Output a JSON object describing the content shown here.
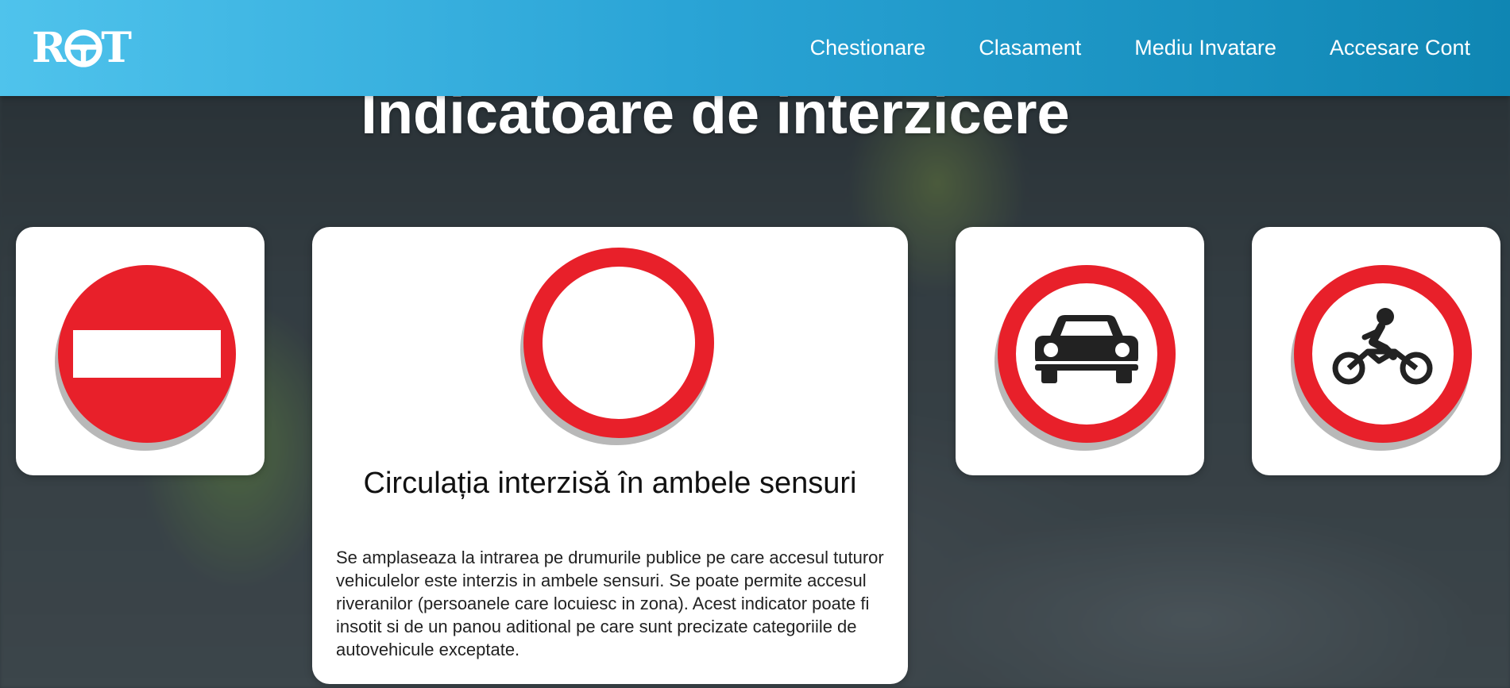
{
  "header": {
    "logo_text_left": "R",
    "logo_text_right": "T",
    "nav": [
      {
        "label": "Chestionare"
      },
      {
        "label": "Clasament"
      },
      {
        "label": "Mediu Invatare"
      },
      {
        "label": "Accesare Cont"
      }
    ]
  },
  "page_title": "Indicatoare de interzicere",
  "signs": [
    {
      "icon": "no-entry-sign-icon"
    },
    {
      "icon": "no-vehicles-both-directions-sign-icon",
      "title": "Circulația interzisă în ambele sensuri",
      "description": "Se amplaseaza la intrarea pe drumurile publice pe care accesul tuturor vehiculelor este interzis in ambele sensuri. Se poate permite accesul riveranilor (persoanele care locuiesc in zona). Acest indicator poate fi insotit si de un panou aditional pe care sunt precizate categoriile de autovehicule exceptate."
    },
    {
      "icon": "no-cars-sign-icon"
    },
    {
      "icon": "no-motorcycles-sign-icon"
    }
  ],
  "colors": {
    "header_gradient_start": "#4fc3ec",
    "header_gradient_end": "#0f86b3",
    "sign_red": "#e8202a",
    "card_bg": "#ffffff",
    "text_dark": "#111111"
  }
}
